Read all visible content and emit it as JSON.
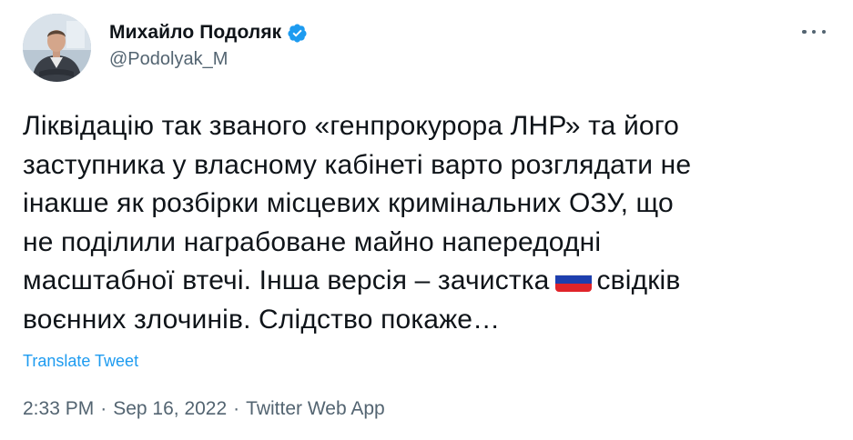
{
  "author": {
    "display_name": "Михайло Подоляк",
    "handle": "@Podolyak_M",
    "verified_icon": "verified-badge-icon",
    "avatar_icon": "avatar"
  },
  "more_icon": "more-horizontal-icon",
  "tweet": {
    "text_line_1": "Ліквідацію так званого «генпрокурора ЛНР» та його",
    "text_line_2": "заступника у власному кабінеті варто розглядати не",
    "text_line_3": "інакше як розбірки місцевих кримінальних ОЗУ, що",
    "text_line_4": "не поділили награбоване майно напередодні",
    "text_line_5_before_flag": "масштабної втечі. Інша версія – зачистка",
    "flag_icon": "russian-flag-emoji",
    "text_line_5_after_flag": "свідків",
    "text_line_6": "воєнних злочинів. Слідство покаже…"
  },
  "translate_label": "Translate Tweet",
  "meta": {
    "time": "2:33 PM",
    "separator": "·",
    "date": "Sep 16, 2022",
    "source": "Twitter Web App"
  },
  "colors": {
    "text": "#0f1419",
    "secondary": "#536471",
    "link": "#1d9bf0",
    "verified": "#1d9bf0"
  }
}
